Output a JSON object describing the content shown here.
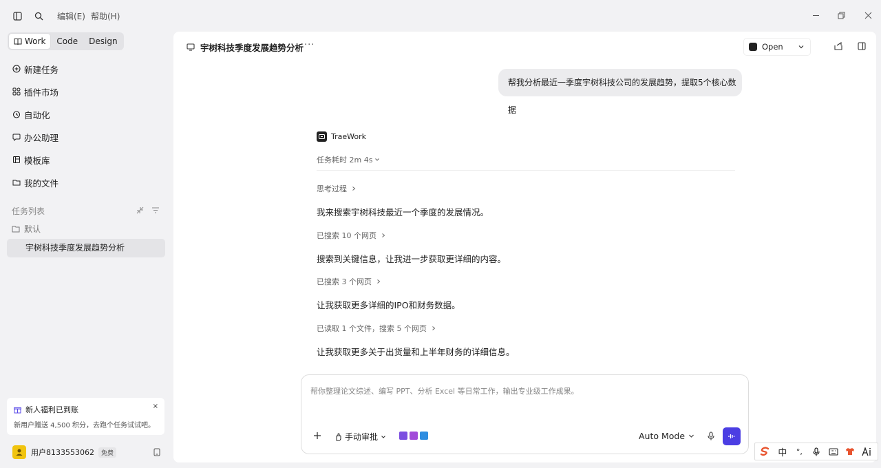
{
  "titlebar": {
    "menus": [
      {
        "label": "编辑(E)"
      },
      {
        "label": "帮助(H)"
      }
    ]
  },
  "sidebar": {
    "mode_tabs": [
      {
        "label": "Work",
        "active": true
      },
      {
        "label": "Code",
        "active": false
      },
      {
        "label": "Design",
        "active": false
      }
    ],
    "nav": [
      {
        "label": "新建任务",
        "icon": "plus-circle-icon"
      },
      {
        "label": "插件市场",
        "icon": "plugin-grid-icon"
      },
      {
        "label": "自动化",
        "icon": "clock-icon"
      },
      {
        "label": "办公助理",
        "icon": "chat-icon"
      },
      {
        "label": "模板库",
        "icon": "template-icon"
      },
      {
        "label": "我的文件",
        "icon": "folder-icon"
      }
    ],
    "task_section_label": "任务列表",
    "folder_label": "默认",
    "active_task": "宇树科技季度发展趋势分析",
    "promo": {
      "title": "新人福利已到账",
      "desc": "新用户赠送 4,500 积分，去跑个任务试试吧。",
      "close": "×"
    },
    "user": {
      "name": "用户8133553062",
      "plan": "免费"
    }
  },
  "main": {
    "doc_title": "宇树科技季度发展趋势分析",
    "more": "···",
    "open_button": "Open",
    "user_message": "帮我分析最近一季度宇树科技公司的发展趋势，提取5个核心数据",
    "bot_name": "TraeWork",
    "duration": "任务耗时 2m 4s",
    "steps": [
      {
        "type": "meta",
        "text": "思考过程"
      },
      {
        "type": "text",
        "text": "我来搜索宇树科技最近一个季度的发展情况。"
      },
      {
        "type": "meta",
        "text": "已搜索 10 个网页"
      },
      {
        "type": "text",
        "text": "搜索到关键信息，让我进一步获取更详细的内容。"
      },
      {
        "type": "meta",
        "text": "已搜索 3 个网页"
      },
      {
        "type": "text",
        "text": "让我获取更多详细的IPO和财务数据。"
      },
      {
        "type": "meta",
        "text": "已读取 1 个文件，搜索 5 个网页"
      },
      {
        "type": "text",
        "text": "让我获取更多关于出货量和上半年财务的详细信息。"
      }
    ],
    "composer": {
      "placeholder": "帮你整理论文综述、编写 PPT、分析 Excel 等日常工作，输出专业级工作成果。",
      "approval": "手动审批",
      "mode": "Auto Mode"
    }
  },
  "ime": {
    "items": [
      "中",
      "°,"
    ]
  },
  "colors": {
    "accent": "#4b3ee3",
    "sidebar_bg": "#f2f2f4",
    "selected_bg": "#e4e4e7"
  }
}
